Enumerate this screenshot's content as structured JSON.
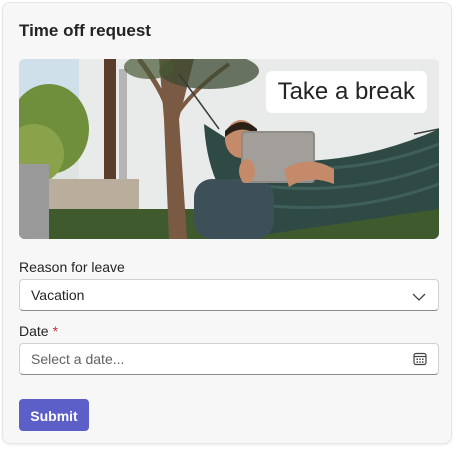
{
  "card": {
    "title": "Time off request",
    "hero_badge": "Take a break"
  },
  "form": {
    "reason_label": "Reason for leave",
    "reason_value": "Vacation",
    "date_label": "Date",
    "date_required_mark": "*",
    "date_placeholder": "Select a date..."
  },
  "actions": {
    "submit_label": "Submit"
  },
  "colors": {
    "accent": "#5b5fc7",
    "required": "#c4314b"
  },
  "icons": {
    "reason_dropdown": "chevron-down-icon",
    "date_picker": "calendar-icon"
  }
}
